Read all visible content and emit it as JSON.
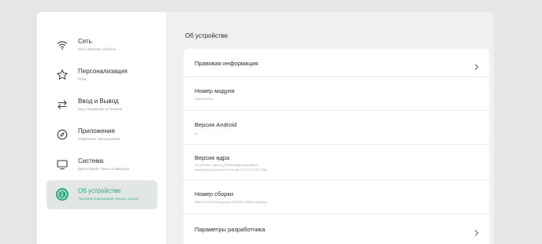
{
  "sidebar": {
    "items": [
      {
        "label": "Сеть",
        "sub": "Wi-Fi, Bluetooth, Ethernet",
        "icon": "wifi-icon"
      },
      {
        "label": "Персонализация",
        "sub": "Обои",
        "icon": "star-icon"
      },
      {
        "label": "Ввод и Вывод",
        "sub": "Звук, Параметры источников",
        "icon": "arrows-swap-icon"
      },
      {
        "label": "Приложения",
        "sub": "Управление приложениями",
        "icon": "compass-icon"
      },
      {
        "label": "Система",
        "sub": "Дата и Время, Язык и клавиатура",
        "icon": "monitor-icon"
      },
      {
        "label": "Об устройстве",
        "sub": "Правовая информация, Версия Android",
        "icon": "info-icon",
        "active": true
      }
    ]
  },
  "main": {
    "title": "Об устройстве",
    "rows": [
      {
        "label": "Правовая информация",
        "value": "",
        "chevron": true
      },
      {
        "label": "Номер модуля",
        "value": "IonaPoseidON"
      },
      {
        "label": "Версия Android",
        "value": "11"
      },
      {
        "label": "Версия ядра",
        "value": "5.4.125-ww++-ak11.0-g775a37be6ab-dirty-ab8470\nuser@s15-20-6-24-user2 #1 Fri Apr 7 17:47:17 CST 2025"
      },
      {
        "label": "Номер сборки",
        "value": "RBXA.211001.000.eng.user2.20230401.153044 test-keys"
      },
      {
        "label": "Параметры разработчика",
        "value": "",
        "chevron": true
      }
    ]
  },
  "colors": {
    "accent": "#2fa886",
    "active_bg": "#e2e6e4",
    "page_bg": "#e6e6e8"
  }
}
